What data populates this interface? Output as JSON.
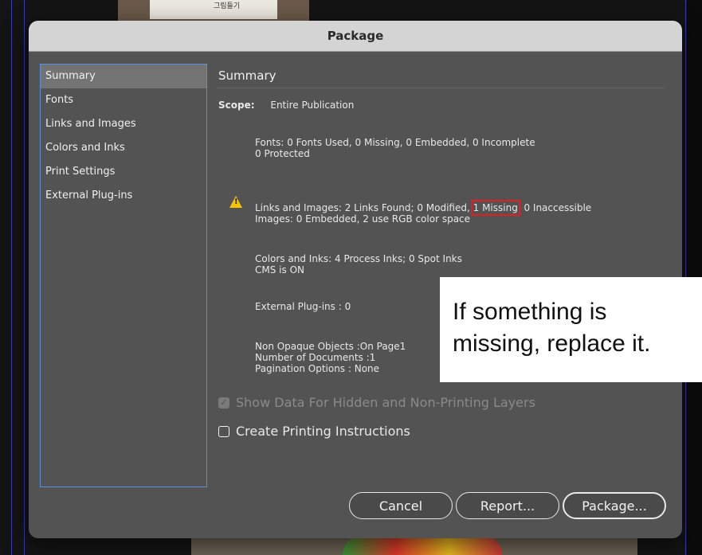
{
  "background": {
    "paper_text": "그림들기"
  },
  "dialog": {
    "title": "Package",
    "sidebar": [
      {
        "label": "Summary",
        "active": true
      },
      {
        "label": "Fonts"
      },
      {
        "label": "Links and Images"
      },
      {
        "label": "Colors and Inks"
      },
      {
        "label": "Print Settings"
      },
      {
        "label": "External Plug-ins"
      }
    ],
    "section_title": "Summary",
    "scope_label": "Scope:",
    "scope_value": "Entire Publication",
    "fonts_line1": "Fonts: 0 Fonts Used, 0 Missing, 0 Embedded, 0 Incomplete",
    "fonts_line2": "0 Protected",
    "links_prefix": "Links and Images: 2 Links Found; 0 Modified,",
    "links_missing": "1 Missing",
    "links_suffix": ", 0 Inaccessible",
    "links_line2": "Images: 0 Embedded, 2 use RGB color space",
    "colors_line1": "Colors and Inks: 4 Process Inks; 0 Spot Inks",
    "colors_line2": "CMS is ON",
    "plugins_line": "External Plug-ins : 0",
    "nonopaque_line1": "Non Opaque Objects :On Page1",
    "nonopaque_line2": "Number of Documents :1",
    "nonopaque_line3": "Pagination Options : None",
    "show_hidden_label": "Show Data For Hidden and Non-Printing Layers",
    "show_hidden_checked": true,
    "print_instructions_label": "Create Printing Instructions",
    "print_instructions_checked": false,
    "buttons": {
      "cancel": "Cancel",
      "report": "Report...",
      "package": "Package..."
    }
  },
  "callout": {
    "line1": "If something is",
    "line2": "missing, replace it."
  },
  "colors": {
    "accent_blue": "#5b8fd8",
    "warning": "#f4c400",
    "highlight_red": "#e02020"
  }
}
